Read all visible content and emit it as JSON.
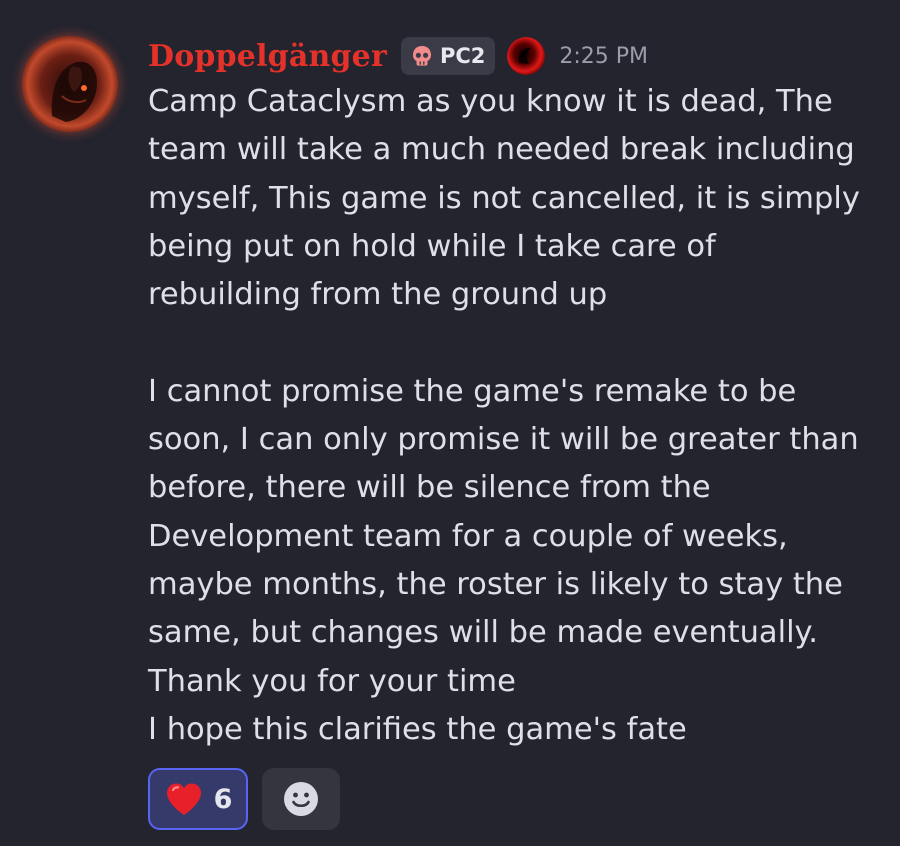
{
  "message": {
    "author": {
      "name": "Doppelgänger",
      "name_color": "#e4322b",
      "avatar_icon": "red-moon-creature-avatar"
    },
    "tag": {
      "icon": "skull-icon",
      "label": "PC2"
    },
    "role_icon": "red-black-orb-icon",
    "timestamp": "2:25 PM",
    "lines": [
      "Camp Cataclysm as you know it is dead, The",
      "team will take a much needed break including",
      "myself, This game is not cancelled, it is simply",
      "being put on hold while I take care of",
      "rebuilding from the ground up",
      "",
      "I cannot promise the game's remake to be",
      "soon, I can only promise it will be greater than",
      "before, there will be silence from the",
      "Development team for a couple of weeks,",
      "maybe months, the roster is likely to stay the",
      "same, but changes will be made eventually.",
      "Thank you for your time",
      "I hope this clarifies the game's fate"
    ]
  },
  "reactions": [
    {
      "emoji": "red-heart-icon",
      "count": "6",
      "selected": true
    }
  ],
  "add_reaction_icon": "smiley-icon",
  "colors": {
    "background": "#23242e",
    "selected_reaction_bg": "#363a6a",
    "selected_reaction_border": "#5865f2"
  }
}
